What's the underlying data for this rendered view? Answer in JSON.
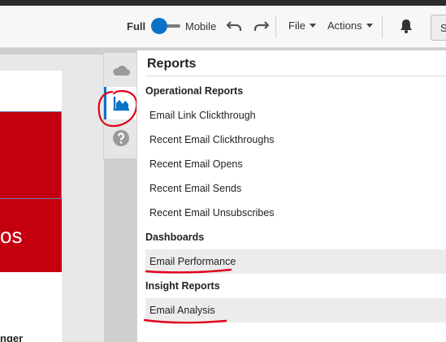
{
  "toolbar": {
    "full_label": "Full",
    "mobile_label": "Mobile",
    "file_label": "File",
    "actions_label": "Actions",
    "button_partial": "S"
  },
  "left_card": {
    "hero_text": "os",
    "bottom_text": "nger"
  },
  "side_tabs": [
    {
      "icon": "cloud-icon"
    },
    {
      "icon": "chart-icon"
    },
    {
      "icon": "help-icon"
    }
  ],
  "reports": {
    "title": "Reports",
    "sections": [
      {
        "label": "Operational Reports",
        "items": [
          "Email Link Clickthrough",
          "Recent Email Clickthroughs",
          "Recent Email Opens",
          "Recent Email Sends",
          "Recent Email Unsubscribes"
        ]
      },
      {
        "label": "Dashboards",
        "items": [
          "Email Performance"
        ]
      },
      {
        "label": "Insight Reports",
        "items": [
          "Email Analysis"
        ]
      }
    ]
  },
  "colors": {
    "accent": "#0a73c7",
    "brand_red": "#c4000f",
    "annotation": "#e0001b"
  }
}
